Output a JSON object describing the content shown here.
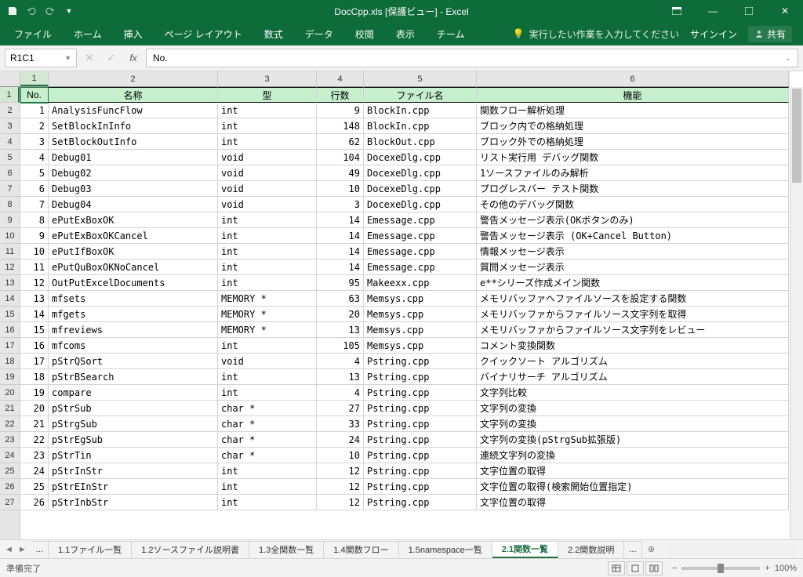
{
  "window": {
    "title": "DocCpp.xls [保護ビュー] - Excel"
  },
  "qat": {
    "save": "保存",
    "undo": "元に戻す",
    "redo": "やり直し",
    "customize": "▾"
  },
  "win_controls": {
    "ribbon_opts": "▭",
    "min": "—",
    "max": "☐",
    "close": "✕"
  },
  "ribbon": {
    "tabs": [
      "ファイル",
      "ホーム",
      "挿入",
      "ページ レイアウト",
      "数式",
      "データ",
      "校閲",
      "表示",
      "チーム"
    ],
    "tell_me": "実行したい作業を入力してください",
    "sign_in": "サインイン",
    "share": "共有"
  },
  "namebox": "R1C1",
  "formula": "No.",
  "col_headers": [
    "1",
    "2",
    "3",
    "4",
    "5",
    "6"
  ],
  "row_headers": [
    "1",
    "2",
    "3",
    "4",
    "5",
    "6",
    "7",
    "8",
    "9",
    "10",
    "11",
    "12",
    "13",
    "14",
    "15",
    "16",
    "17",
    "18",
    "19",
    "20",
    "21",
    "22",
    "23",
    "24",
    "25",
    "26",
    "27"
  ],
  "header_row": [
    "No.",
    "名称",
    "型",
    "行数",
    "ファイル名",
    "機能"
  ],
  "chart_data": {
    "type": "table",
    "columns": [
      "No.",
      "名称",
      "型",
      "行数",
      "ファイル名",
      "機能"
    ],
    "rows": [
      [
        "1",
        "AnalysisFuncFlow",
        "int",
        "9",
        "BlockIn.cpp",
        "関数フロー解析処理"
      ],
      [
        "2",
        "SetBlockInInfo",
        "int",
        "148",
        "BlockIn.cpp",
        "ブロック内での格納処理"
      ],
      [
        "3",
        "SetBlockOutInfo",
        "int",
        "62",
        "BlockOut.cpp",
        "ブロック外での格納処理"
      ],
      [
        "4",
        "Debug01",
        "void",
        "104",
        "DocexeDlg.cpp",
        "リスト実行用 デバッグ関数"
      ],
      [
        "5",
        "Debug02",
        "void",
        "49",
        "DocexeDlg.cpp",
        "1ソースファイルのみ解析"
      ],
      [
        "6",
        "Debug03",
        "void",
        "10",
        "DocexeDlg.cpp",
        "プログレスバー テスト関数"
      ],
      [
        "7",
        "Debug04",
        "void",
        "3",
        "DocexeDlg.cpp",
        "その他のデバッグ関数"
      ],
      [
        "8",
        "ePutExBoxOK",
        "int",
        "14",
        "Emessage.cpp",
        "警告メッセージ表示(OKボタンのみ)"
      ],
      [
        "9",
        "ePutExBoxOKCancel",
        "int",
        "14",
        "Emessage.cpp",
        "警告メッセージ表示 (OK+Cancel Button)"
      ],
      [
        "10",
        "ePutIfBoxOK",
        "int",
        "14",
        "Emessage.cpp",
        "情報メッセージ表示"
      ],
      [
        "11",
        "ePutQuBoxOKNoCancel",
        "int",
        "14",
        "Emessage.cpp",
        "質問メッセージ表示"
      ],
      [
        "12",
        "OutPutExcelDocuments",
        "int",
        "95",
        "Makeexx.cpp",
        "e**シリーズ作成メイン関数"
      ],
      [
        "13",
        "mfsets",
        "MEMORY *",
        "63",
        "Memsys.cpp",
        "メモリバッファへファイルソースを設定する関数"
      ],
      [
        "14",
        "mfgets",
        "MEMORY *",
        "20",
        "Memsys.cpp",
        "メモリバッファからファイルソース文字列を取得"
      ],
      [
        "15",
        "mfreviews",
        "MEMORY *",
        "13",
        "Memsys.cpp",
        "メモリバッファからファイルソース文字列をレビュー"
      ],
      [
        "16",
        "mfcoms",
        "int",
        "105",
        "Memsys.cpp",
        "コメント変換関数"
      ],
      [
        "17",
        "pStrQSort",
        "void",
        "4",
        "Pstring.cpp",
        "クイックソート アルゴリズム"
      ],
      [
        "18",
        "pStrBSearch",
        "int",
        "13",
        "Pstring.cpp",
        "バイナリサーチ アルゴリズム"
      ],
      [
        "19",
        "compare",
        "int",
        "4",
        "Pstring.cpp",
        "文字列比較"
      ],
      [
        "20",
        "pStrSub",
        "char *",
        "27",
        "Pstring.cpp",
        "文字列の変換"
      ],
      [
        "21",
        "pStrgSub",
        "char *",
        "33",
        "Pstring.cpp",
        "文字列の変換"
      ],
      [
        "22",
        "pStrEgSub",
        "char *",
        "24",
        "Pstring.cpp",
        "文字列の変換(pStrgSub拡張版)"
      ],
      [
        "23",
        "pStrTin",
        "char *",
        "10",
        "Pstring.cpp",
        "連続文字列の変換"
      ],
      [
        "24",
        "pStrInStr",
        "int",
        "12",
        "Pstring.cpp",
        "文字位置の取得"
      ],
      [
        "25",
        "pStrEInStr",
        "int",
        "12",
        "Pstring.cpp",
        "文字位置の取得(検索開始位置指定)"
      ],
      [
        "26",
        "pStrInbStr",
        "int",
        "12",
        "Pstring.cpp",
        "文字位置の取得"
      ]
    ]
  },
  "sheet_tabs": {
    "overflow": "...",
    "tabs": [
      "1.1ファイル一覧",
      "1.2ソースファイル説明書",
      "1.3全関数一覧",
      "1.4関数フロー",
      "1.5namespace一覧",
      "2.1関数一覧",
      "2.2関数説明"
    ],
    "active_index": 5,
    "more": "...",
    "add": "+"
  },
  "status": {
    "ready": "準備完了",
    "zoom": "100%"
  }
}
